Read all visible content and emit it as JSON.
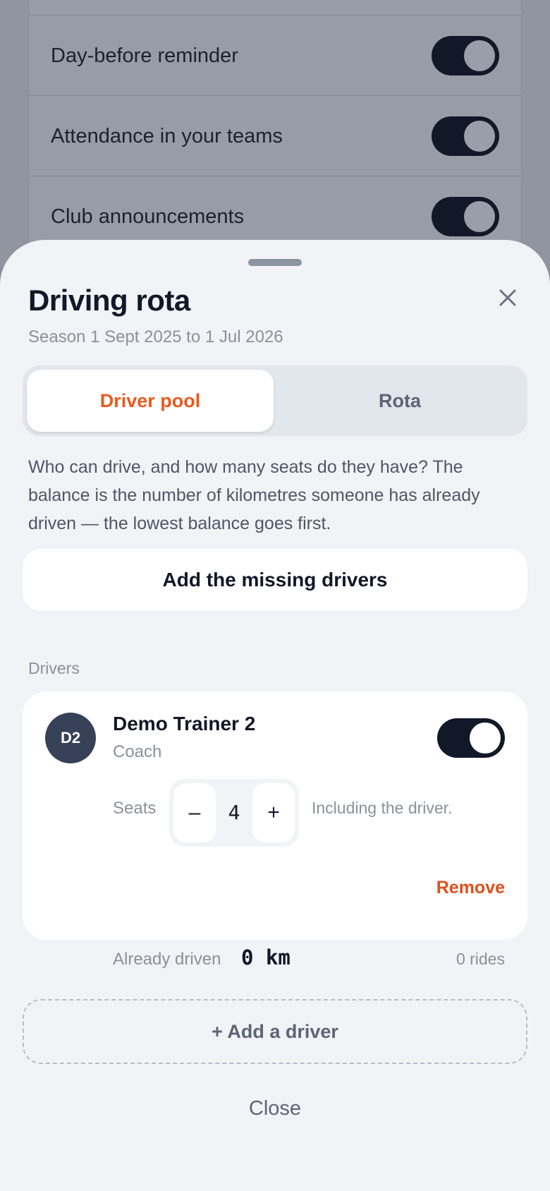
{
  "background": {
    "rows": [
      {
        "label": "Day-before reminder",
        "enabled": true
      },
      {
        "label": "Attendance in your teams",
        "enabled": true
      },
      {
        "label": "Club announcements",
        "enabled": true
      }
    ]
  },
  "sheet": {
    "title": "Driving rota",
    "subtitle": "Season 1 Sept 2025 to 1 Jul 2026",
    "tabs": [
      {
        "label": "Driver pool",
        "active": true
      },
      {
        "label": "Rota",
        "active": false
      }
    ],
    "description": "Who can drive, and how many seats do they have? The balance is the number of kilometres someone has already driven — the lowest balance goes first.",
    "add_missing_label": "Add the missing drivers",
    "section_label": "Drivers",
    "driver": {
      "initials": "D2",
      "name": "Demo Trainer 2",
      "role": "Coach",
      "enabled": true,
      "seats_label": "Seats",
      "minus": "–",
      "seats": "4",
      "plus": "+",
      "seats_note": "Including the driver.",
      "remove_label": "Remove",
      "driven_label": "Already driven",
      "driven_value": "0 km",
      "rides": "0 rides"
    },
    "add_driver_label": "+ Add a driver",
    "close_label": "Close"
  },
  "colors": {
    "accent": "#ea5a1e",
    "danger": "#e0501c",
    "toggle_on": "#111827",
    "avatar": "#374258"
  },
  "icons": {
    "close": "close-icon"
  }
}
